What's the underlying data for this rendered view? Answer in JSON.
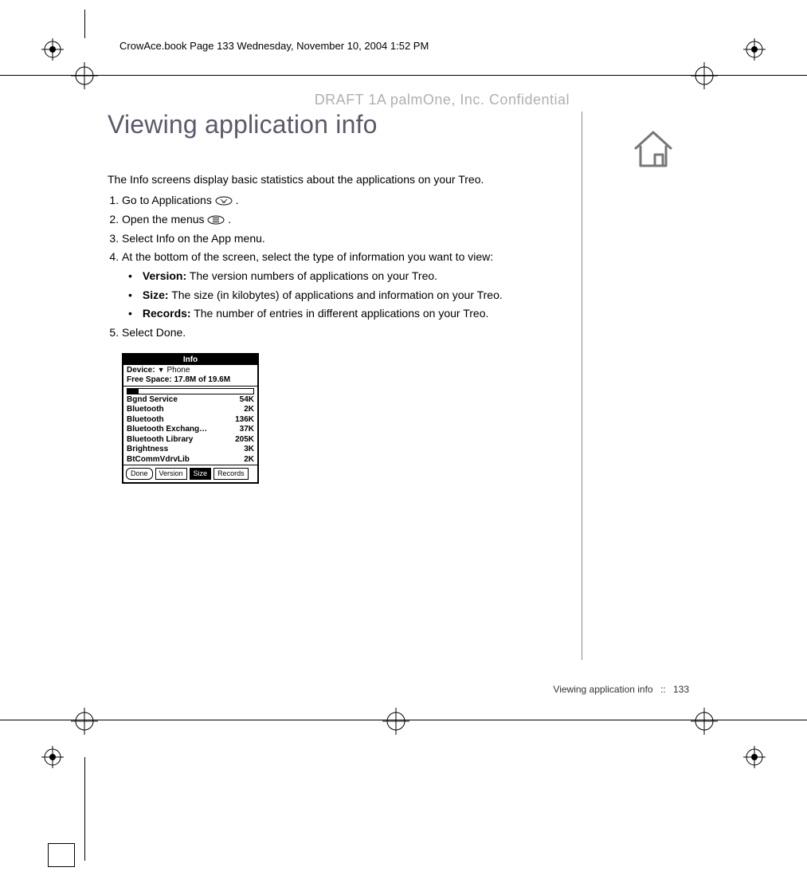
{
  "header_line": "CrowAce.book  Page 133  Wednesday, November 10, 2004  1:52 PM",
  "watermark": "DRAFT 1A  palmOne, Inc.   Confidential",
  "title": "Viewing application info",
  "intro": "The Info screens display basic statistics about the applications on your Treo.",
  "steps": {
    "s1_a": "Go to Applications ",
    "s1_b": ".",
    "s2_a": "Open the menus ",
    "s2_b": ".",
    "s3": "Select Info on the App menu.",
    "s4": "At the bottom of the screen, select the type of information you want to view:",
    "s5": "Select Done."
  },
  "bullets": {
    "version_label": "Version:",
    "version_text": " The version numbers of applications on your Treo.",
    "size_label": "Size:",
    "size_text": " The size (in kilobytes) of applications and information on your Treo.",
    "records_label": "Records:",
    "records_text": " The number of entries in different applications on your Treo."
  },
  "screenshot": {
    "title": "Info",
    "device_label": "Device:",
    "device_value": "Phone",
    "free_space": "Free Space: 17.8M of 19.6M",
    "apps": [
      {
        "name": "Bgnd Service",
        "size": "54K"
      },
      {
        "name": "Bluetooth",
        "size": "2K"
      },
      {
        "name": "Bluetooth",
        "size": "136K"
      },
      {
        "name": "Bluetooth Exchang…",
        "size": "37K"
      },
      {
        "name": "Bluetooth Library",
        "size": "205K"
      },
      {
        "name": "Brightness",
        "size": "3K"
      },
      {
        "name": "BtCommVdrvLib",
        "size": "2K"
      }
    ],
    "buttons": {
      "done": "Done",
      "version": "Version",
      "size": "Size",
      "records": "Records"
    }
  },
  "footer": {
    "section": "Viewing application info",
    "sep": "::",
    "page": "133"
  }
}
